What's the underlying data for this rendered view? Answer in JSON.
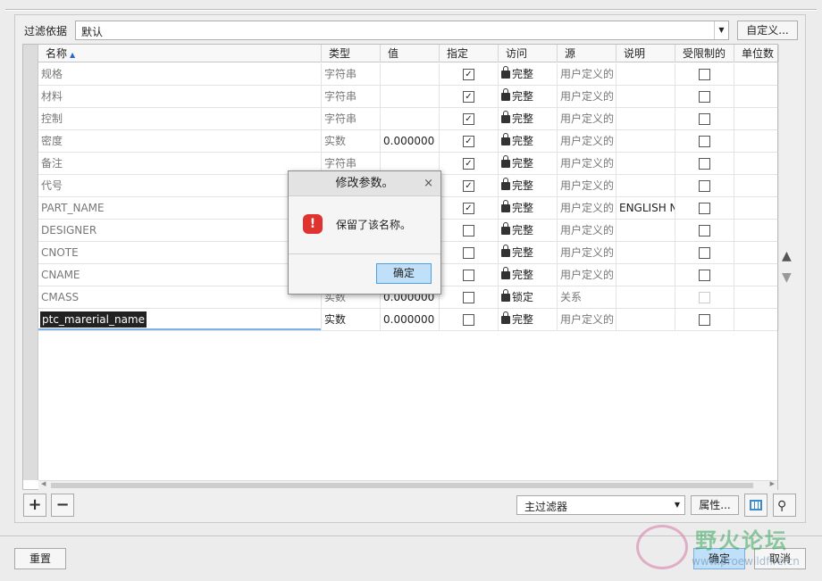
{
  "filter": {
    "label": "过滤依据",
    "value": "默认",
    "custom_button": "自定义..."
  },
  "columns": [
    "名称",
    "类型",
    "值",
    "指定",
    "访问",
    "源",
    "说明",
    "受限制的",
    "单位数"
  ],
  "rows": [
    {
      "name": "规格",
      "type": "字符串",
      "value": "",
      "designate": true,
      "access": "完整",
      "source": "用户定义的",
      "desc": "",
      "restricted": false
    },
    {
      "name": "材料",
      "type": "字符串",
      "value": "",
      "designate": true,
      "access": "完整",
      "source": "用户定义的",
      "desc": "",
      "restricted": false
    },
    {
      "name": "控制",
      "type": "字符串",
      "value": "",
      "designate": true,
      "access": "完整",
      "source": "用户定义的",
      "desc": "",
      "restricted": false
    },
    {
      "name": "密度",
      "type": "实数",
      "value": "0.000000",
      "designate": true,
      "access": "完整",
      "source": "用户定义的",
      "desc": "",
      "restricted": false
    },
    {
      "name": "备注",
      "type": "字符串",
      "value": "",
      "designate": true,
      "access": "完整",
      "source": "用户定义的",
      "desc": "",
      "restricted": false
    },
    {
      "name": "代号",
      "type": "",
      "value": "",
      "designate": true,
      "access": "完整",
      "source": "用户定义的",
      "desc": "",
      "restricted": false
    },
    {
      "name": "PART_NAME",
      "type": "",
      "value": "",
      "designate": true,
      "access": "完整",
      "source": "用户定义的",
      "desc": "ENGLISH N",
      "restricted": false
    },
    {
      "name": "DESIGNER",
      "type": "",
      "value": "",
      "designate": false,
      "access": "完整",
      "source": "用户定义的",
      "desc": "",
      "restricted": false
    },
    {
      "name": "CNOTE",
      "type": "",
      "value": "",
      "designate": false,
      "access": "完整",
      "source": "用户定义的",
      "desc": "",
      "restricted": false
    },
    {
      "name": "CNAME",
      "type": "",
      "value": "",
      "designate": false,
      "access": "完整",
      "source": "用户定义的",
      "desc": "",
      "restricted": false
    },
    {
      "name": "CMASS",
      "type": "实数",
      "value": "0.000000",
      "designate": false,
      "access": "锁定",
      "source": "关系",
      "desc": "",
      "restricted": false
    },
    {
      "name": "ptc_marerial_name",
      "type": "实数",
      "value": "0.000000",
      "designate": false,
      "access": "完整",
      "source": "用户定义的",
      "desc": "",
      "restricted": false
    }
  ],
  "toolbar": {
    "add": "+",
    "remove": "−",
    "main_filter": "主过滤器",
    "properties": "属性..."
  },
  "footer": {
    "reset": "重置",
    "ok": "确定",
    "cancel": "取消"
  },
  "dialog": {
    "title": "修改参数。",
    "close": "×",
    "message": "保留了该名称。",
    "ok": "确定"
  },
  "watermark": {
    "text": "野火论坛",
    "url": "www.proewildfire.cn"
  }
}
